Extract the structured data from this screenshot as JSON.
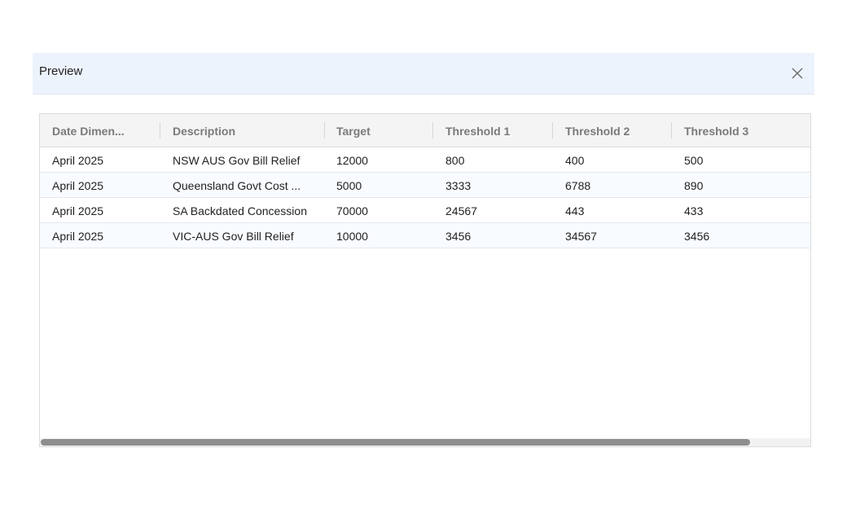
{
  "dialog": {
    "title": "Preview",
    "close_icon": "close-icon"
  },
  "table": {
    "columns": [
      "Date Dimen...",
      "Description",
      "Target",
      "Threshold 1",
      "Threshold 2",
      "Threshold 3"
    ],
    "rows": [
      [
        "April 2025",
        "NSW AUS Gov Bill Relief",
        "12000",
        "800",
        "400",
        "500"
      ],
      [
        "April 2025",
        "Queensland Govt Cost ...",
        "5000",
        "3333",
        "6788",
        "890"
      ],
      [
        "April 2025",
        "SA Backdated Concession",
        "70000",
        "24567",
        "443",
        "433"
      ],
      [
        "April 2025",
        "VIC-AUS Gov Bill Relief",
        "10000",
        "3456",
        "34567",
        "3456"
      ]
    ]
  },
  "colors": {
    "header_bg": "#edf3fd",
    "grid_header_bg": "#f4f4f4",
    "scroll_thumb": "#8e8e8e"
  }
}
